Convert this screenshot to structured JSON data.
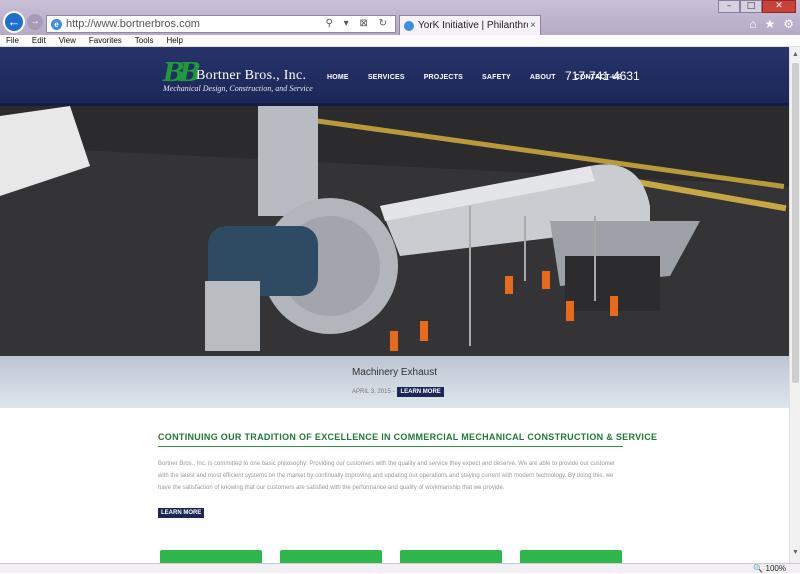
{
  "browser": {
    "url": "http://www.bortnerbros.com",
    "tab_title": "YorK Initiative | Philanthrop...",
    "tab_close": "×",
    "address_tools": "⚲ ▾ ⊠ ↻",
    "menu": [
      "File",
      "Edit",
      "View",
      "Favorites",
      "Tools",
      "Help"
    ],
    "zoom": "100%",
    "zoom_icon": "magnifier-icon"
  },
  "site": {
    "logo_mark": "BB",
    "logo_name": "Bortner Bros., Inc.",
    "logo_tagline": "Mechanical Design, Construction, and Service",
    "nav": [
      "HOME",
      "SERVICES",
      "PROJECTS",
      "SAFETY",
      "ABOUT",
      "CONTACT US"
    ],
    "phone": "717-741-4631"
  },
  "hero": {
    "caption_title": "Machinery Exhaust",
    "caption_date": "APRIL 3, 2015 -",
    "caption_button": "LEARN MORE"
  },
  "intro": {
    "heading": "CONTINUING OUR TRADITION OF EXCELLENCE IN COMMERCIAL MECHANICAL CONSTRUCTION & SERVICE",
    "body": "Bortner Bros., Inc. is committed to one basic philosophy: Providing our customers with the quality and service they expect and deserve. We are able to provide our customer with the latest and most efficient systems on the market by continually improving and updating our operations and staying current with modern technology. By doing this, we have the satisfaction of knowing that our customers are satisfied with the performance and quality of workmanship that we provide.",
    "button": "LEARN MORE"
  },
  "colors": {
    "header_navy": "#1c2758",
    "brand_green": "#2fb64c",
    "heading_green": "#1e7a34"
  }
}
